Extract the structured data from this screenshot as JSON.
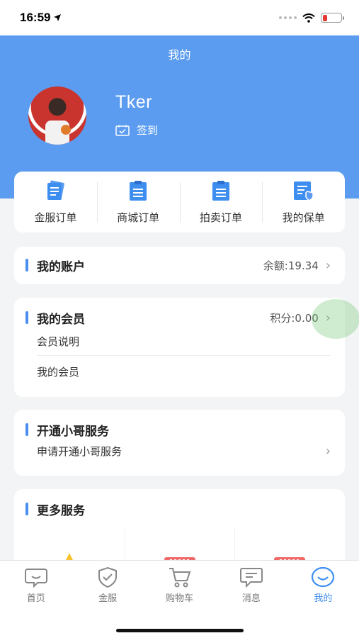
{
  "status": {
    "time": "16:59"
  },
  "header": {
    "title": "我的",
    "username": "Tker",
    "signin_label": "签到"
  },
  "orders": [
    {
      "label": "金服订单",
      "icon": "document-icon"
    },
    {
      "label": "商城订单",
      "icon": "clipboard-icon"
    },
    {
      "label": "拍卖订单",
      "icon": "clipboard-icon"
    },
    {
      "label": "我的保单",
      "icon": "policy-icon"
    }
  ],
  "account": {
    "title": "我的账户",
    "balance": "余额:19.34"
  },
  "member": {
    "title": "我的会员",
    "points": "积分:0.00",
    "rows": [
      "会员说明",
      "我的会员"
    ]
  },
  "courier": {
    "title": "开通小哥服务",
    "row": "申请开通小哥服务"
  },
  "more": {
    "title": "更多服务"
  },
  "tabs": [
    {
      "label": "首页",
      "icon": "home-icon"
    },
    {
      "label": "金服",
      "icon": "shield-icon"
    },
    {
      "label": "购物车",
      "icon": "cart-icon"
    },
    {
      "label": "消息",
      "icon": "message-icon"
    },
    {
      "label": "我的",
      "icon": "profile-icon",
      "active": true
    }
  ],
  "colors": {
    "header": "#5b9cf0",
    "accent": "#3e8ef0"
  }
}
